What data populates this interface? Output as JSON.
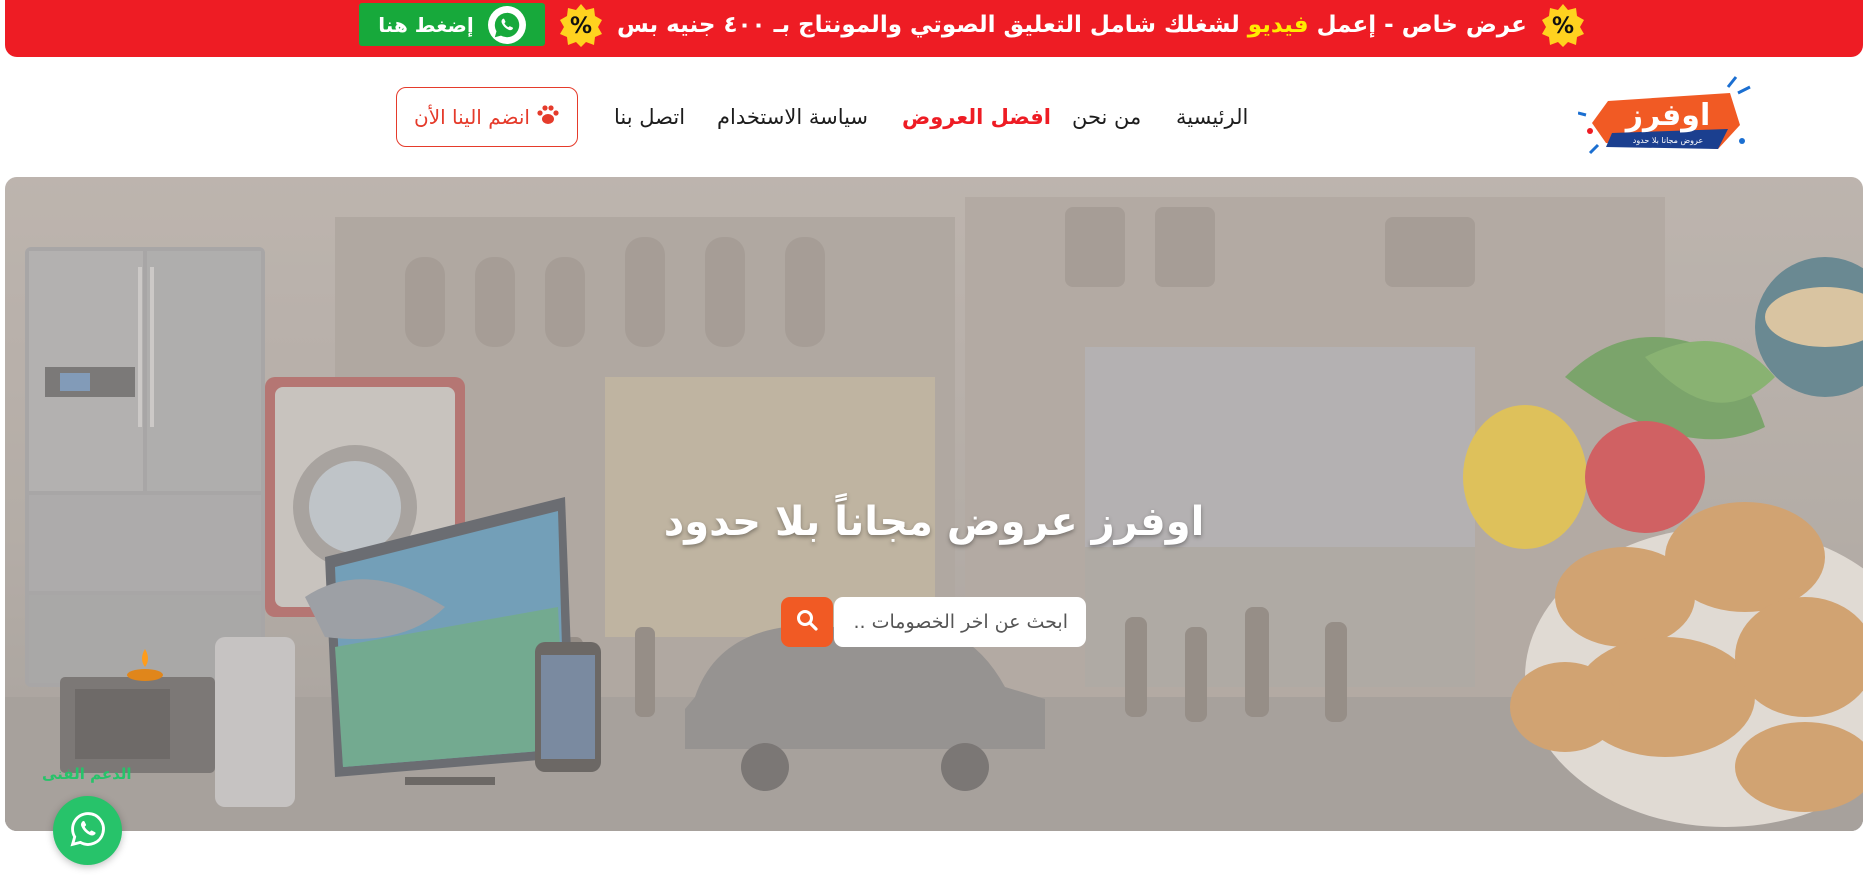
{
  "promo": {
    "prefix": "عرض خاص  -  إعمل ",
    "highlight": "فيديو",
    "suffix": " لشغلك شامل التعليق الصوتي والمونتاج بـ ٤٠٠ جنيه بس",
    "button_label": "إضغط هنا",
    "badge_text": "%",
    "colors": {
      "bar": "#ee1c24",
      "highlight": "#ffeb00",
      "button": "#17a93b"
    }
  },
  "header": {
    "logo_text": "اوفرز",
    "logo_tagline": "عروض مجانا بلا حدود",
    "nav": [
      {
        "label": "الرئيسية",
        "active": false
      },
      {
        "label": "من نحن",
        "active": false
      },
      {
        "label": "افضل العروض",
        "active": true
      },
      {
        "label": "سياسة الاستخدام",
        "active": false
      },
      {
        "label": "اتصل بنا",
        "active": false
      }
    ],
    "join_label": "انضم الينا الأن",
    "join_icon": "paw-icon",
    "colors": {
      "accent": "#ee1c24",
      "join": "#e53b2b"
    }
  },
  "hero": {
    "title": "اوفرز عروض مجاناً بلا حدود",
    "search": {
      "placeholder": "ابحث عن اخر الخصومات ..",
      "icon": "search-icon"
    },
    "colors": {
      "search_button": "#f15a24"
    }
  },
  "support": {
    "label": "الدعم الفنى",
    "icon": "whatsapp-icon",
    "color": "#27c36a"
  }
}
